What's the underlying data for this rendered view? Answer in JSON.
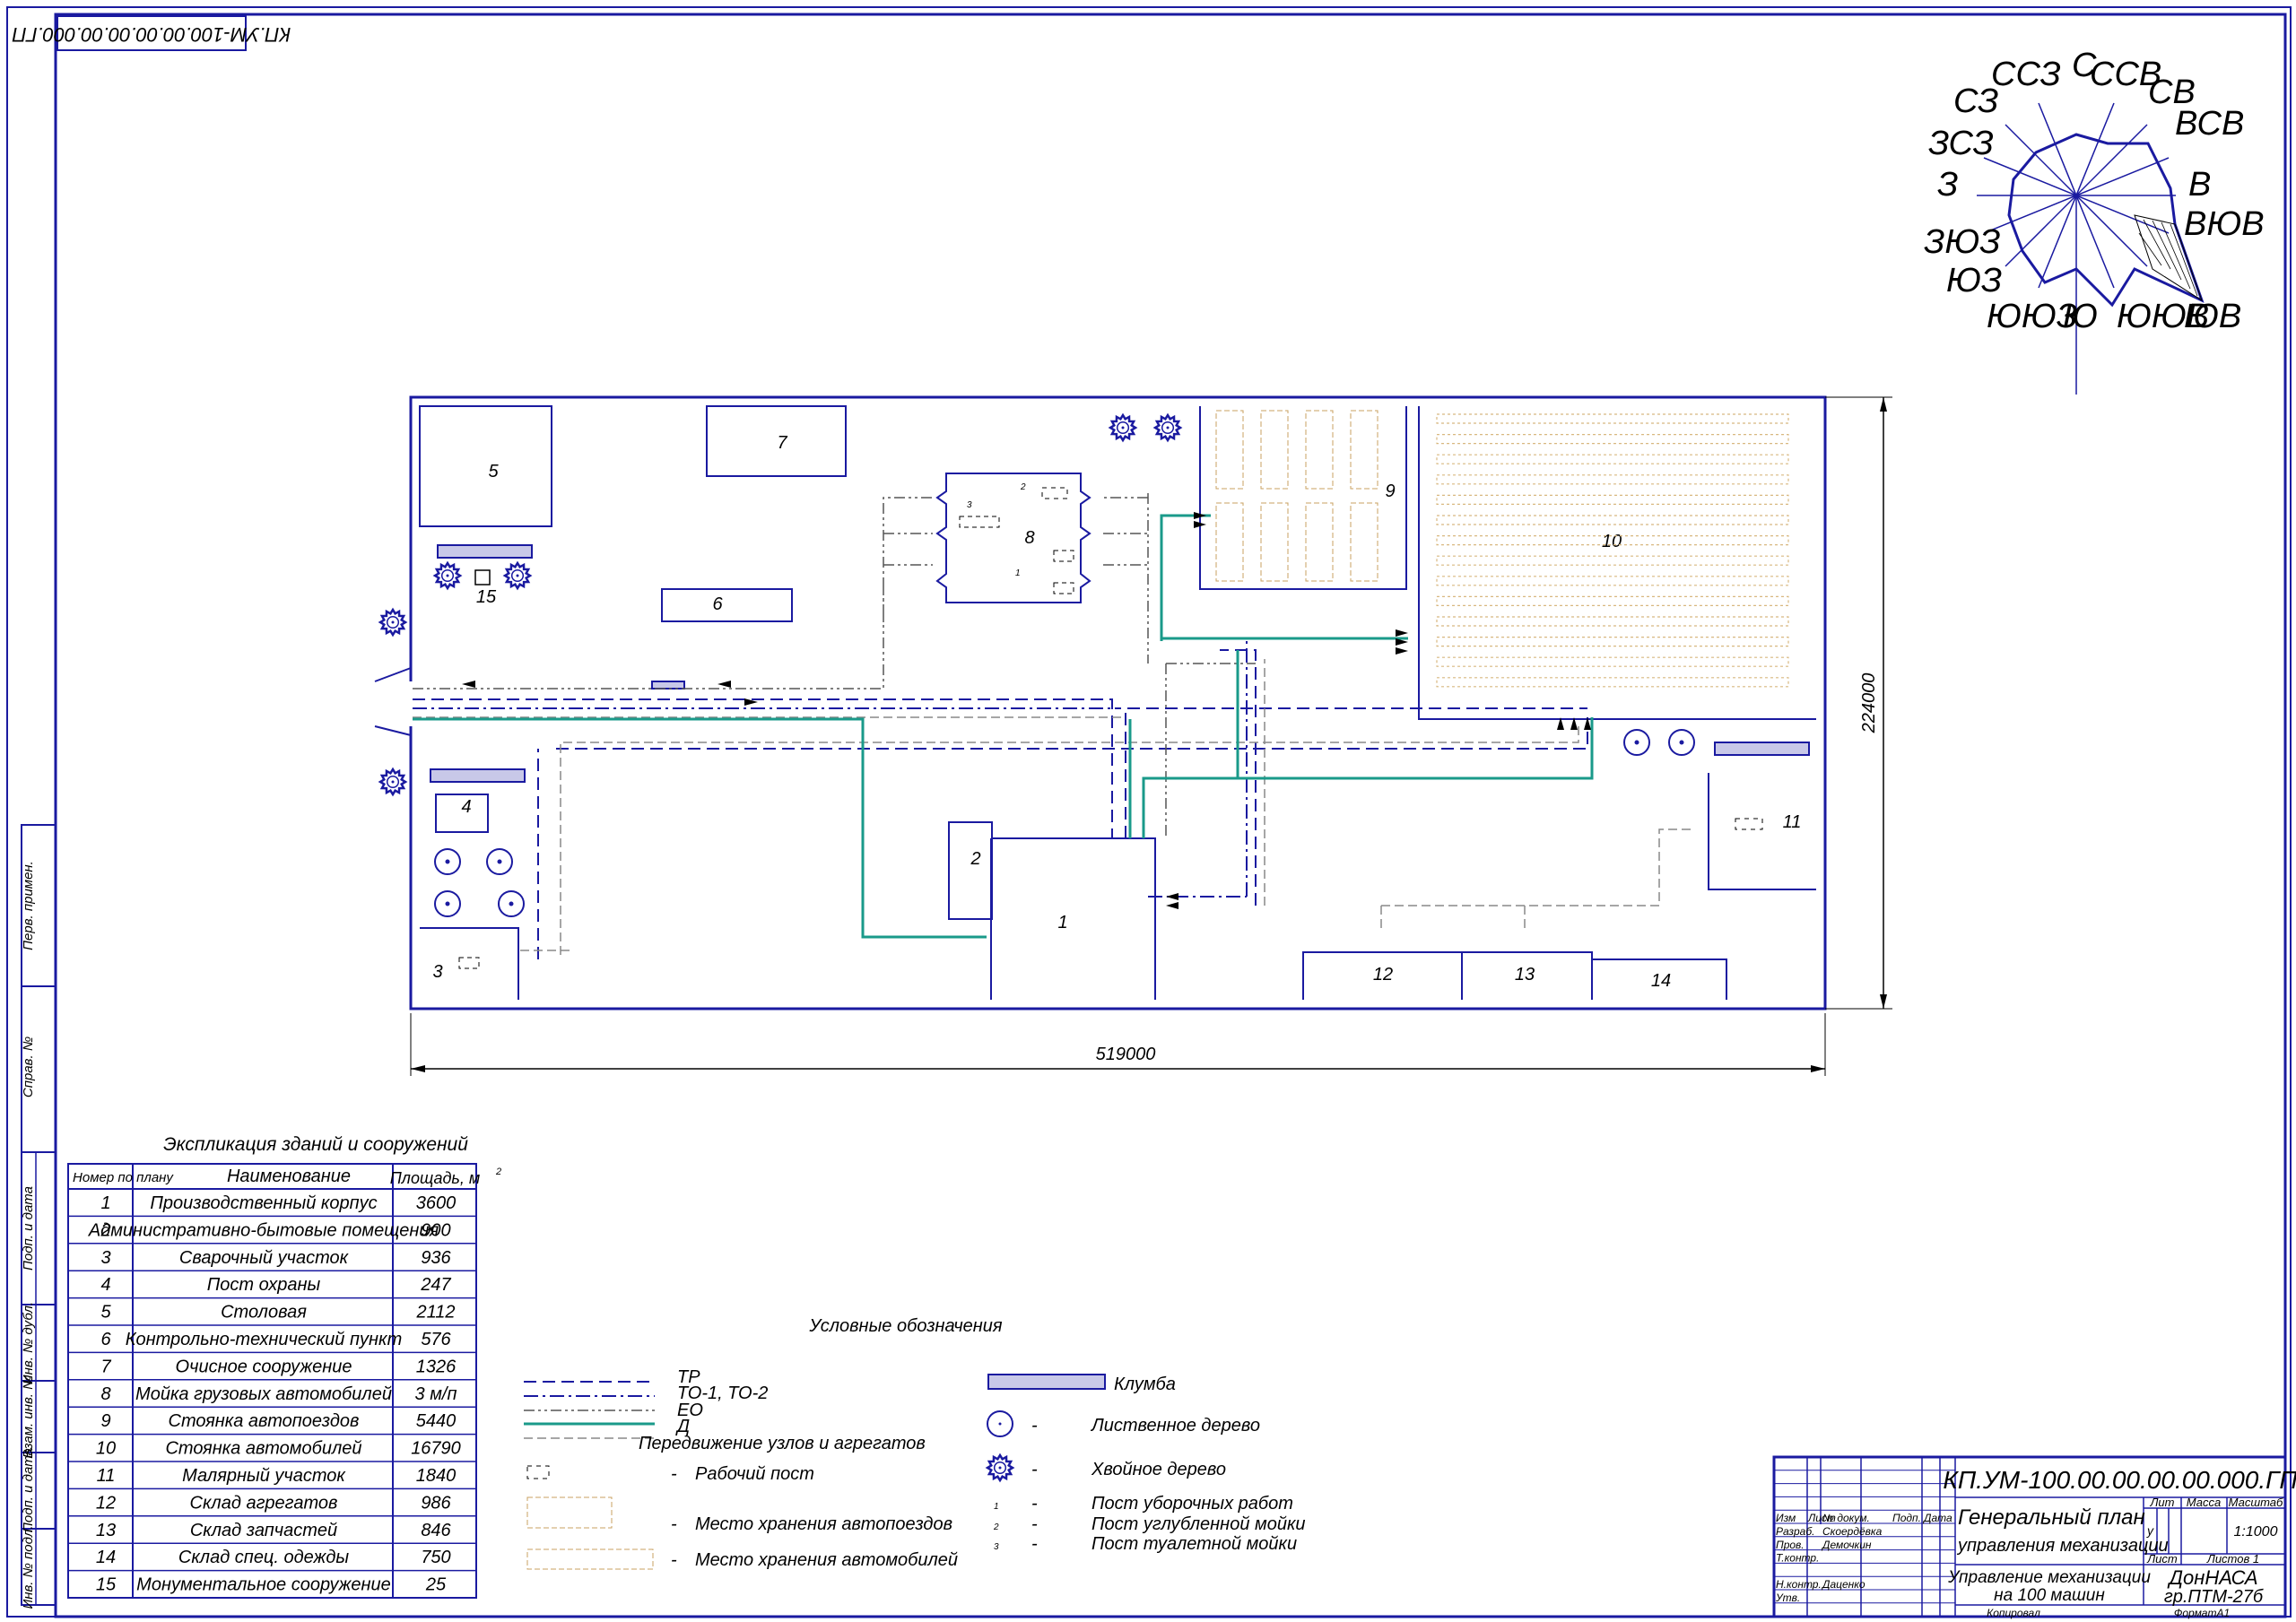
{
  "stamp_rotated": "КП.УМ-100.00.00.00.00.000.ГП",
  "compass": [
    "ССЗ",
    "С",
    "ССВ",
    "СВ",
    "ВСВ",
    "В",
    "ВЮВ",
    "ЮВ",
    "ЮЮВ",
    "Ю",
    "ЮЮЗ",
    "ЮЗ",
    "ЗЮЗ",
    "З",
    "ЗСЗ",
    "СЗ"
  ],
  "plan": {
    "buildings": [
      "1",
      "2",
      "3",
      "4",
      "5",
      "6",
      "7",
      "8",
      "9",
      "10",
      "11",
      "12",
      "13",
      "14",
      "15"
    ],
    "sub_labels": [
      "1",
      "2",
      "3"
    ],
    "dim_width": "519000",
    "dim_height": "224000"
  },
  "explication": {
    "title": "Экспликация зданий и сооружений",
    "headers": [
      "Номер по плану",
      "Наименование",
      "Площадь, м",
      "2"
    ],
    "rows": [
      [
        "1",
        "Производственный корпус",
        "3600"
      ],
      [
        "2",
        "Административно-бытовые помещения",
        "900"
      ],
      [
        "3",
        "Сварочный участок",
        "936"
      ],
      [
        "4",
        "Пост охраны",
        "247"
      ],
      [
        "5",
        "Столовая",
        "2112"
      ],
      [
        "6",
        "Контрольно-технический пункт",
        "576"
      ],
      [
        "7",
        "Очисное сооружение",
        "1326"
      ],
      [
        "8",
        "Мойка грузовых автомобилей",
        "3 м/п"
      ],
      [
        "9",
        "Стоянка автопоездов",
        "5440"
      ],
      [
        "10",
        "Стоянка автомобилей",
        "16790"
      ],
      [
        "11",
        "Малярный участок",
        "1840"
      ],
      [
        "12",
        "Склад агрегатов",
        "986"
      ],
      [
        "13",
        "Склад запчастей",
        "846"
      ],
      [
        "14",
        "Склад спец. одежды",
        "750"
      ],
      [
        "15",
        "Монументальное сооружение",
        "25"
      ]
    ]
  },
  "side_labels": [
    "Перв. примен.",
    "Справ. №",
    "Подп. и дата",
    "Инв. № дубл.",
    "Взам. инв. №",
    "Подп. и дата",
    "Инв. № подл."
  ],
  "legend": {
    "title": "Условные обозначения",
    "lines": [
      "ТР",
      "ТО-1, ТО-2",
      "ЕО",
      "Д",
      "Передвижение узлов и агрегатов"
    ],
    "dash": "-",
    "items": [
      "Рабочий пост",
      "Место хранения автопоездов",
      "Место хранения автомобилей"
    ],
    "klumba": "Клумба",
    "trees": [
      "Лиственное дерево",
      "Хвойное дерево"
    ],
    "posts_nums": [
      "1",
      "2",
      "3"
    ],
    "posts": [
      "Пост уборочных работ",
      "Пост углубленной мойки",
      "Пост туалетной мойки"
    ]
  },
  "titleblock": {
    "code": "КП.УМ-100.00.00.00.00.000.ГП",
    "title1": "Генеральный план",
    "title2": "управления механизации",
    "sub1": "Управление механизации",
    "sub2": "на 100 машин",
    "org1": "ДонНАСА",
    "org2": "гр.ПТМ-27б",
    "col_heads": [
      "Изм",
      "Лист",
      "№ докум.",
      "Подп.",
      "Дата"
    ],
    "roles": [
      "Разраб.",
      "Пров.",
      "Т.контр.",
      "",
      "Н.контр.",
      "Утв."
    ],
    "names": [
      "Скоердёвка",
      "Демочкин",
      "",
      "",
      "Даценко",
      ""
    ],
    "lit": "Лит",
    "mass": "Масса",
    "scale_h": "Масштаб",
    "lit_val": "у",
    "scale": "1:1000",
    "sheet": "Лист",
    "sheets": "Листов 1",
    "copied": "Копировал",
    "format": "ФорматА1"
  }
}
